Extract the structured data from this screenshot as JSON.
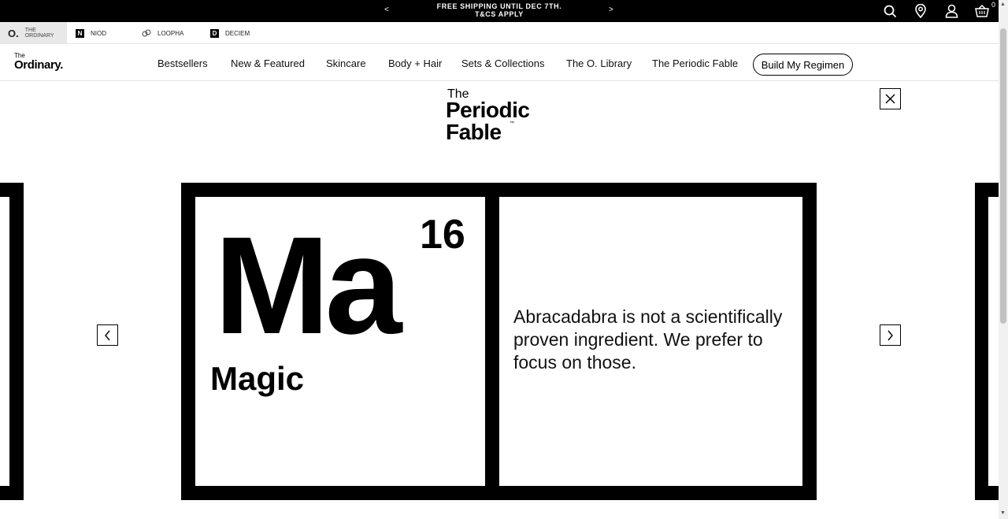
{
  "promo": {
    "prev": "<",
    "next": ">",
    "line1": "FREE SHIPPING UNTIL DEC 7TH.",
    "line2": "T&CS APPLY"
  },
  "header_icons": {
    "search": "search-icon",
    "location": "location-pin-icon",
    "account": "user-icon",
    "cart": "basket-icon",
    "cart_count": "0"
  },
  "brands": [
    {
      "mark": "O.",
      "label_line1": "THE",
      "label_line2": "ORDINARY",
      "active": true
    },
    {
      "mark": "N",
      "label": "NIOD"
    },
    {
      "mark": "loopha-icon",
      "label": "LOOPHA"
    },
    {
      "mark": "D",
      "label": "DECIEM"
    }
  ],
  "logo": {
    "small": "The",
    "big": "Ordinary."
  },
  "nav": {
    "items": [
      "Bestsellers",
      "New & Featured",
      "Skincare",
      "Body + Hair",
      "Sets & Collections",
      "The O. Library",
      "The Periodic Fable"
    ],
    "cta": "Build My Regimen"
  },
  "hero": {
    "logo_the": "The",
    "logo_line1": "Periodic",
    "logo_line2": "Fable",
    "logo_tm": "™",
    "element_symbol": "Ma",
    "element_number": "16",
    "element_name": "Magic",
    "description": "Abracadabra is not a scientifically proven ingredient. We prefer to focus on those."
  },
  "colors": {
    "primary": "#000000",
    "background": "#ffffff",
    "brand_active_bg": "#e8e8e8"
  }
}
